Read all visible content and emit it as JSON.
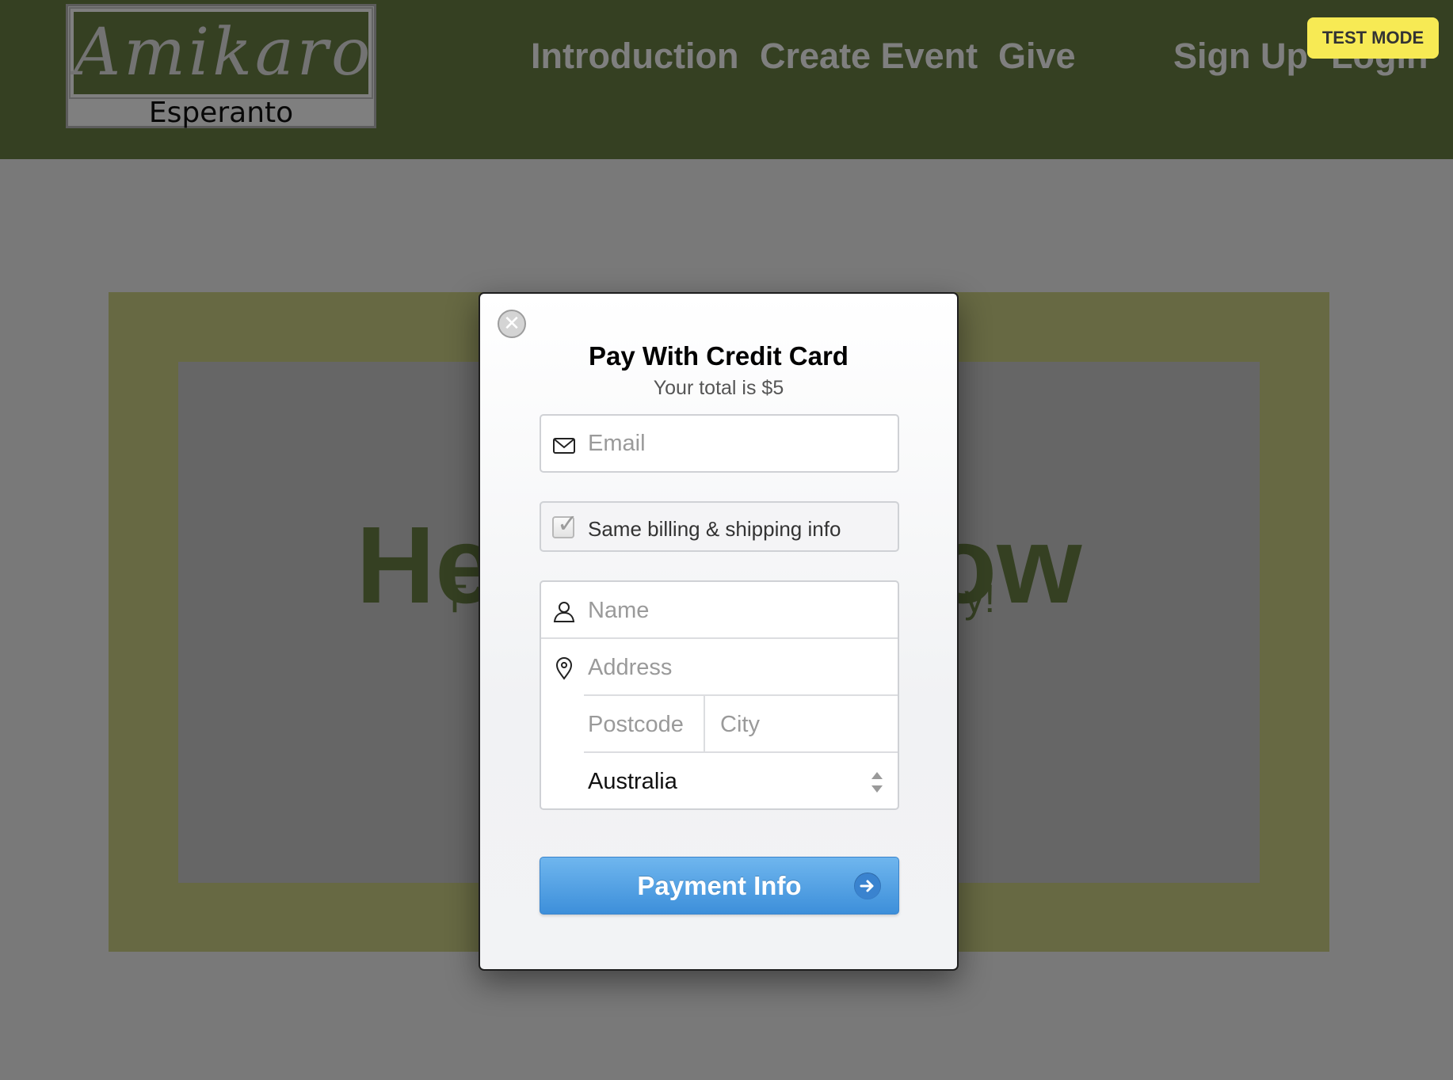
{
  "site": {
    "logo_top": "Amikaro",
    "logo_bottom": "Esperanto",
    "nav": {
      "introduction": "Introduction",
      "create_event": "Create Event",
      "give": "Give",
      "sign_up": "Sign Up",
      "login": "Login"
    },
    "hero_title_left": "He",
    "hero_title_right": "ow",
    "hero_sub_left": "T",
    "hero_sub_right": "y!"
  },
  "test_mode_label": "TEST MODE",
  "modal": {
    "title": "Pay With Credit Card",
    "subtitle": "Your total is $5",
    "email": {
      "placeholder": "Email",
      "value": "",
      "icon": "envelope-icon"
    },
    "same_info": {
      "label": "Same billing & shipping info",
      "checked": true
    },
    "name": {
      "placeholder": "Name",
      "value": "",
      "icon": "person-icon"
    },
    "address": {
      "placeholder": "Address",
      "value": "",
      "icon": "location-pin-icon"
    },
    "postcode": {
      "placeholder": "Postcode",
      "value": ""
    },
    "city": {
      "placeholder": "City",
      "value": ""
    },
    "country": {
      "selected": "Australia"
    },
    "submit_label": "Payment Info",
    "close_icon": "close-icon"
  },
  "colors": {
    "brand_green": "#6b8145",
    "button_blue": "#4a9ae0",
    "test_badge": "#f7ea54"
  }
}
